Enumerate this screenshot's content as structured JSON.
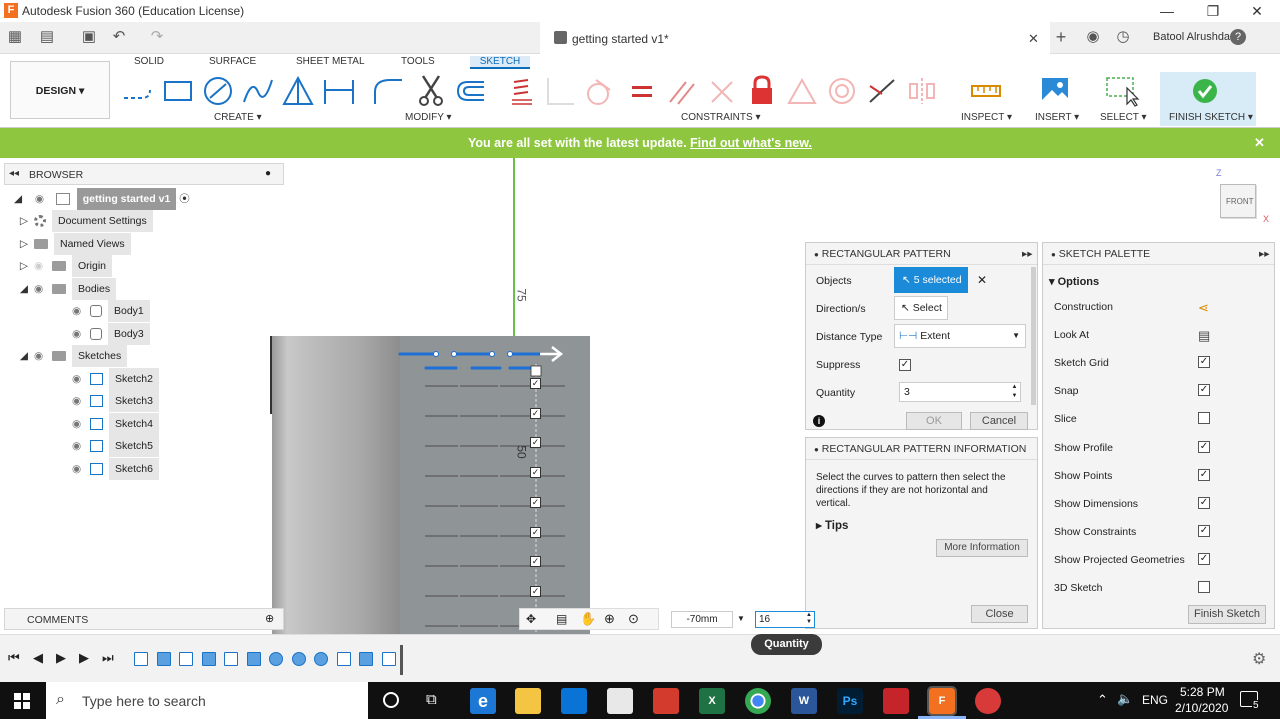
{
  "title_bar": {
    "app_title": "Autodesk Fusion 360 (Education License)",
    "minimize": "—",
    "restore": "❐",
    "close": "✕"
  },
  "document": {
    "tab_name": "getting started v1*",
    "user": "Batool Alrushdan",
    "close_glyph": "✕",
    "add_glyph": "+",
    "help_glyph": "?"
  },
  "ribbon": {
    "design_label": "DESIGN ▾",
    "tabs": [
      "SOLID",
      "SURFACE",
      "SHEET METAL",
      "TOOLS",
      "SKETCH"
    ],
    "active_tab": "SKETCH",
    "groups": {
      "create": "CREATE ▾",
      "modify": "MODIFY ▾",
      "constraints": "CONSTRAINTS ▾",
      "inspect": "INSPECT ▾",
      "insert": "INSERT ▾",
      "select": "SELECT ▾",
      "finish_sketch": "FINISH SKETCH ▾"
    }
  },
  "banner": {
    "text": "You are all set with the latest update.",
    "link": "Find out what's new.",
    "close": "✕"
  },
  "browser": {
    "header": "BROWSER",
    "root": "getting started v1",
    "items": [
      {
        "label": "Document Settings",
        "level": 1
      },
      {
        "label": "Named Views",
        "level": 1
      },
      {
        "label": "Origin",
        "level": 1
      },
      {
        "label": "Bodies",
        "level": 1
      },
      {
        "label": "Body1",
        "level": 2
      },
      {
        "label": "Body3",
        "level": 2
      },
      {
        "label": "Sketches",
        "level": 1
      },
      {
        "label": "Sketch2",
        "level": 2
      },
      {
        "label": "Sketch3",
        "level": 2
      },
      {
        "label": "Sketch4",
        "level": 2
      },
      {
        "label": "Sketch5",
        "level": 2
      },
      {
        "label": "Sketch6",
        "level": 2
      }
    ]
  },
  "comments": {
    "header": "COMMENTS"
  },
  "viewcube": {
    "face": "FRONT",
    "z_axis": "Z",
    "x_axis": "X"
  },
  "canvas_labels": {
    "dim_75": "75",
    "dim_50": "50"
  },
  "rect_pattern": {
    "header": "RECTANGULAR PATTERN",
    "objects_label": "Objects",
    "objects_value": "5 selected",
    "directions_label": "Direction/s",
    "directions_value": "Select",
    "distance_type_label": "Distance Type",
    "distance_type_value": "Extent",
    "suppress_label": "Suppress",
    "suppress_checked": true,
    "quantity_label": "Quantity",
    "quantity_value": "3",
    "ok": "OK",
    "cancel": "Cancel"
  },
  "rect_info": {
    "header": "RECTANGULAR PATTERN INFORMATION",
    "body": "Select the curves to pattern then select the directions if they are not horizontal and vertical.",
    "tips": "Tips",
    "more_info": "More Information",
    "close": "Close"
  },
  "sketch_palette": {
    "header": "SKETCH PALETTE",
    "options_label": "Options",
    "rows": [
      {
        "label": "Construction",
        "type": "icon"
      },
      {
        "label": "Look At",
        "type": "icon"
      },
      {
        "label": "Sketch Grid",
        "type": "check",
        "checked": true
      },
      {
        "label": "Snap",
        "type": "check",
        "checked": true
      },
      {
        "label": "Slice",
        "type": "check",
        "checked": false
      },
      {
        "label": "Show Profile",
        "type": "check",
        "checked": true
      },
      {
        "label": "Show Points",
        "type": "check",
        "checked": true
      },
      {
        "label": "Show Dimensions",
        "type": "check",
        "checked": true
      },
      {
        "label": "Show Constraints",
        "type": "check",
        "checked": true
      },
      {
        "label": "Show Projected Geometries",
        "type": "check",
        "checked": true
      },
      {
        "label": "3D Sketch",
        "type": "check",
        "checked": false
      }
    ],
    "finish_button": "Finish Sketch"
  },
  "input_bar": {
    "distance_value": "-70mm",
    "quantity_value": "16",
    "tooltip": "Quantity"
  },
  "taskbar": {
    "search_placeholder": "Type here to search",
    "language": "ENG",
    "time": "5:28 PM",
    "date": "2/10/2020",
    "notification_count": "5"
  }
}
